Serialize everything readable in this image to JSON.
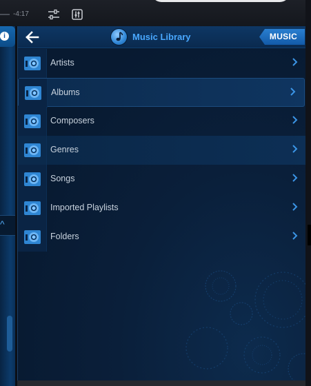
{
  "topbar": {
    "time_remaining": "-4:17",
    "icons": [
      "mixer-sliders-icon",
      "equalizer-icon"
    ]
  },
  "left_panel": {
    "info_label": "i",
    "collapse_glyph": "^"
  },
  "header": {
    "title": "Music Library",
    "music_tab_label": "MUSIC",
    "back_icon": "back-arrow-icon",
    "title_icon": "music-note-icon"
  },
  "list": {
    "items": [
      {
        "label": "Artists",
        "icon": "library-item-icon"
      },
      {
        "label": "Albums",
        "icon": "library-item-icon"
      },
      {
        "label": "Composers",
        "icon": "library-item-icon"
      },
      {
        "label": "Genres",
        "icon": "library-item-icon"
      },
      {
        "label": "Songs",
        "icon": "library-item-icon"
      },
      {
        "label": "Imported Playlists",
        "icon": "library-item-icon"
      },
      {
        "label": "Folders",
        "icon": "library-item-icon"
      }
    ]
  },
  "colors": {
    "accent": "#49a8ff",
    "panel_bg": "#081a31",
    "tab_bg": "#135aa8"
  }
}
